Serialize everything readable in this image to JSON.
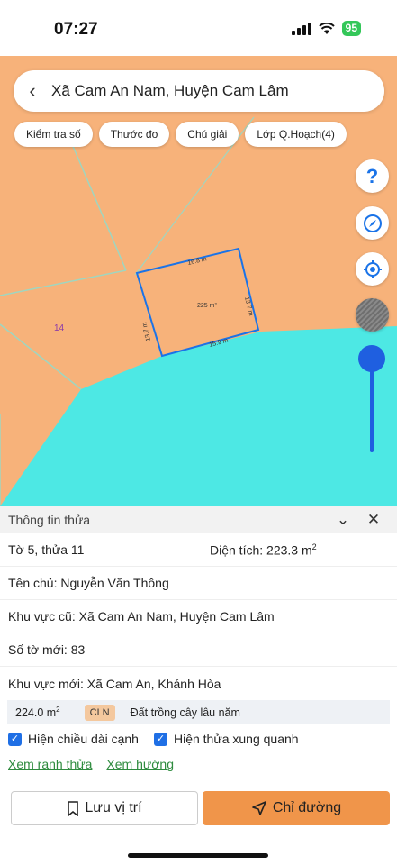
{
  "status_bar": {
    "time": "07:27",
    "battery": "95"
  },
  "search": {
    "location_title": "Xã Cam An Nam, Huyện Cam Lâm"
  },
  "toolbar": {
    "chips": [
      "Kiểm tra số",
      "Thước đo",
      "Chú giải",
      "Lớp Q.Hoạch(4)"
    ]
  },
  "map": {
    "edge_top": "16.8 m",
    "edge_right": "13.7 m",
    "edge_bottom": "15.9 m",
    "edge_left": "13.7 m",
    "parcel_area": "225 m²",
    "neighbor_parcel": "14",
    "colors": {
      "land": "#f7b27a",
      "water": "#4de8e4",
      "parcel_outline": "#1a73e8",
      "accent": "#f0954a"
    }
  },
  "map_controls": {
    "help": "question-icon",
    "compass": "compass-icon",
    "locate": "locate-icon",
    "layer": "satellite-layer-icon"
  },
  "info_panel": {
    "header": "Thông tin thửa",
    "sheet_parcel": "Tờ 5, thửa 11",
    "area_label": "Diện tích: 223.3 m",
    "area_sup": "2",
    "owner": "Tên chủ: Nguyễn Văn Thông",
    "old_area": "Khu vực cũ: Xã Cam An Nam, Huyện Cam Lâm",
    "new_sheet": "Số tờ mới: 83",
    "new_area": "Khu vực mới: Xã Cam An, Khánh Hòa",
    "land_use": {
      "area": "224.0 m",
      "area_sup": "2",
      "code": "CLN",
      "description": "Đất trồng cây lâu năm"
    },
    "checkbox_edges": "Hiện chiều dài cạnh",
    "checkbox_neighbors": "Hiện thửa xung quanh",
    "link_boundaries": "Xem ranh thửa",
    "link_direction": "Xem hướng",
    "save_button": "Lưu vị trí",
    "directions_button": "Chỉ đường"
  }
}
